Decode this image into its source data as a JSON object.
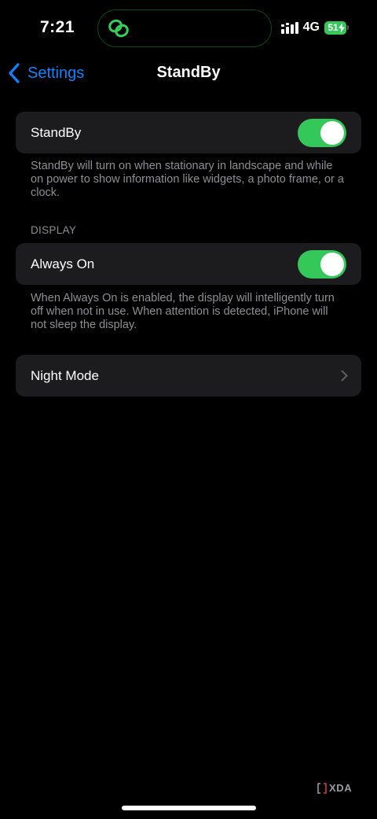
{
  "status_bar": {
    "time": "7:21",
    "network": "4G",
    "battery_level": "51",
    "island_icon": "link-rings-icon"
  },
  "nav": {
    "back_label": "Settings",
    "title": "StandBy"
  },
  "standby_group": {
    "label": "StandBy",
    "toggle_on": true,
    "footer": "StandBy will turn on when stationary in landscape and while on power to show information like widgets, a photo frame, or a clock."
  },
  "display_section": {
    "header": "DISPLAY",
    "always_on_label": "Always On",
    "toggle_on": true,
    "footer": "When Always On is enabled, the display will intelligently turn off when not in use. When attention is detected, iPhone will not sleep the display."
  },
  "night_mode": {
    "label": "Night Mode"
  },
  "watermark": {
    "text": "XDA"
  },
  "colors": {
    "accent_blue": "#0a84ff",
    "toggle_green": "#34c759",
    "cell_background": "#1c1c1e",
    "secondary_text": "#8e8e93"
  }
}
